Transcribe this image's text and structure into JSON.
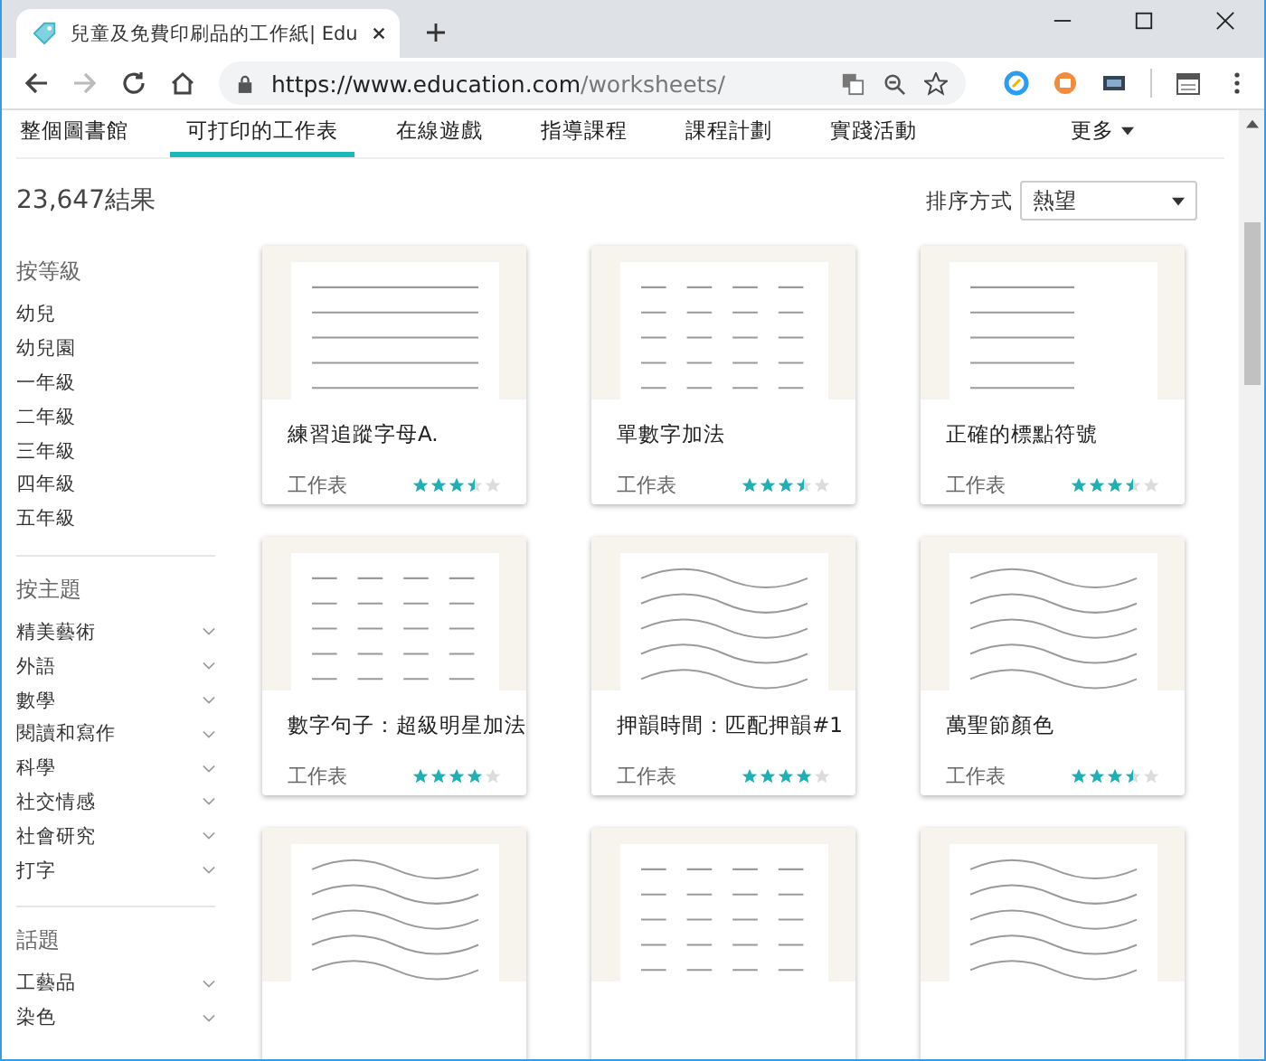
{
  "browser": {
    "tab_title": "兒童及免費印刷品的工作紙| Edu",
    "url_host": "https://www.education.com",
    "url_path": "/worksheets/"
  },
  "nav": {
    "tabs": [
      {
        "label": "整個圖書館",
        "selected": false
      },
      {
        "label": "可打印的工作表",
        "selected": true
      },
      {
        "label": "在線遊戲",
        "selected": false
      },
      {
        "label": "指導課程",
        "selected": false
      },
      {
        "label": "課程計劃",
        "selected": false
      },
      {
        "label": "實踐活動",
        "selected": false
      }
    ],
    "more": "更多"
  },
  "results": "23,647結果",
  "sort": {
    "label": "排序方式",
    "value": "熱望"
  },
  "sidebar": [
    {
      "heading": "按等級",
      "items": [
        {
          "label": "幼兒",
          "expandable": false
        },
        {
          "label": "幼兒園",
          "expandable": false
        },
        {
          "label": "一年級",
          "expandable": false
        },
        {
          "label": "二年級",
          "expandable": false
        },
        {
          "label": "三年級",
          "expandable": false
        },
        {
          "label": "四年級",
          "expandable": false
        },
        {
          "label": "五年級",
          "expandable": false
        }
      ]
    },
    {
      "heading": "按主題",
      "items": [
        {
          "label": "精美藝術",
          "expandable": true
        },
        {
          "label": "外語",
          "expandable": true
        },
        {
          "label": "數學",
          "expandable": true
        },
        {
          "label": "閱讀和寫作",
          "expandable": true
        },
        {
          "label": "科學",
          "expandable": true
        },
        {
          "label": "社交情感",
          "expandable": true
        },
        {
          "label": "社會研究",
          "expandable": true
        },
        {
          "label": "打字",
          "expandable": true
        }
      ]
    },
    {
      "heading": "話題",
      "items": [
        {
          "label": "工藝品",
          "expandable": true
        },
        {
          "label": "染色",
          "expandable": true
        }
      ]
    }
  ],
  "cards": [
    {
      "kind": "tracing",
      "title": "練習追蹤字母A.",
      "type": "工作表",
      "stars": 3.5
    },
    {
      "kind": "math",
      "title": "單數字加法",
      "type": "工作表",
      "stars": 3.5
    },
    {
      "kind": "text",
      "title": "正確的標點符號",
      "type": "工作表",
      "stars": 3.5
    },
    {
      "kind": "math",
      "title": "數字句子：超級明星加法",
      "type": "工作表",
      "stars": 4
    },
    {
      "kind": "coloring",
      "title": "押韻時間：匹配押韻#1",
      "type": "工作表",
      "stars": 4
    },
    {
      "kind": "coloring",
      "title": "萬聖節顏色",
      "type": "工作表",
      "stars": 3.5
    },
    {
      "kind": "coloring"
    },
    {
      "kind": "math"
    },
    {
      "kind": "coloring"
    }
  ]
}
